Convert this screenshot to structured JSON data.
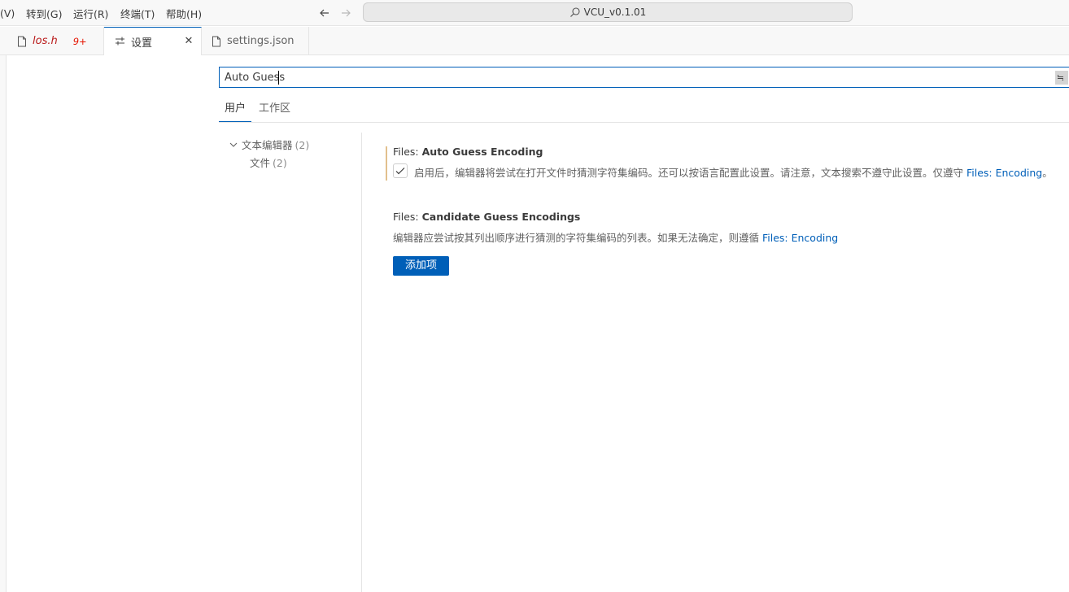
{
  "menu": {
    "items": [
      "(V)",
      "转到(G)",
      "运行(R)",
      "终端(T)",
      "帮助(H)"
    ]
  },
  "command_center": {
    "label": "VCU_v0.1.01"
  },
  "tabs": [
    {
      "label": "los.h",
      "badge": "9+",
      "icon": "file-icon"
    },
    {
      "label": "设置",
      "icon": "settings-icon",
      "active": true
    },
    {
      "label": "settings.json",
      "icon": "file-icon"
    }
  ],
  "search": {
    "value": "Auto Guess"
  },
  "scopes": {
    "user": "用户",
    "workspace": "工作区"
  },
  "toc": {
    "group_label": "文本编辑器",
    "group_count": "(2)",
    "child_label": "文件",
    "child_count": "(2)"
  },
  "settings": [
    {
      "category": "Files: ",
      "name": "Auto Guess Encoding",
      "description": "启用后，编辑器将尝试在打开文件时猜测字符集编码。还可以按语言配置此设置。请注意，文本搜索不遵守此设置。仅遵守 ",
      "link": "Files: Encoding",
      "suffix": "。",
      "checked": true
    },
    {
      "category": "Files: ",
      "name": "Candidate Guess Encodings",
      "description": "编辑器应尝试按其列出顺序进行猜测的字符集编码的列表。如果无法确定，则遵循 ",
      "link": "Files: Encoding",
      "button": "添加项"
    }
  ],
  "colors": {
    "accent": "#005fb8",
    "modified_indicator": "#e2c08d",
    "error": "#e51400"
  }
}
